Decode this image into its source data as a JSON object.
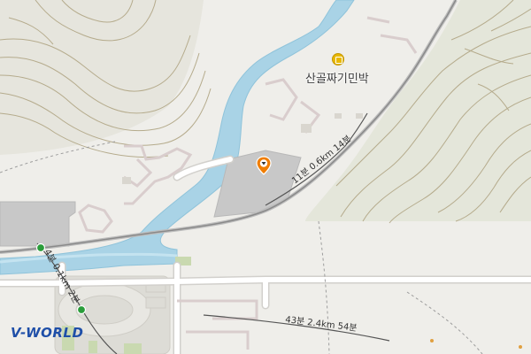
{
  "map": {
    "poi": {
      "name": "산골짜기민박",
      "icon": "lodging-icon"
    },
    "selected_marker": {
      "icon": "location-pin-icon",
      "color": "#f07d00"
    },
    "routes": [
      {
        "label": "11분 0.6km 14분"
      },
      {
        "label": "4분 0.1km 2분"
      },
      {
        "label": "43분 2.4km 54분"
      }
    ],
    "colors": {
      "background": "#efeeea",
      "water": "#a9d3e6",
      "water_edge": "#8fc3da",
      "contour": "#b5ab8c",
      "road": "#ffffff",
      "road_edge": "#d2d0cc",
      "area_gray": "#c8c8c8",
      "route_line": "#555555"
    }
  },
  "logo": {
    "text": "V-WORLD"
  }
}
